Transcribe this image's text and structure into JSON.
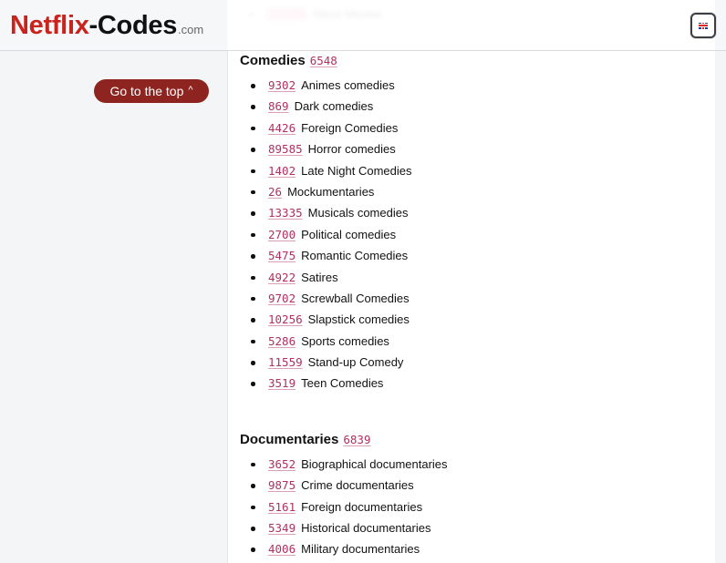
{
  "header": {
    "logo_part1": "Netflix",
    "logo_part2": "-Codes",
    "logo_suffix": ".com",
    "language_button": {
      "icon": "uk-flag-icon",
      "label": "English"
    }
  },
  "blurred_previous_item": {
    "code": "12228",
    "label": "Silent Movies"
  },
  "sidebar": {
    "go_top_label": "Go to the top",
    "go_top_icon": "chevron-up-icon"
  },
  "colors": {
    "brand_red": "#c8231c",
    "button_bg": "#8e2420",
    "link": "#b03060"
  },
  "sections": [
    {
      "title": "Comedies",
      "code": "6548",
      "items": [
        {
          "code": "9302",
          "label": "Animes comedies"
        },
        {
          "code": "869",
          "label": "Dark comedies"
        },
        {
          "code": "4426",
          "label": "Foreign Comedies"
        },
        {
          "code": "89585",
          "label": "Horror comedies"
        },
        {
          "code": "1402",
          "label": "Late Night Comedies"
        },
        {
          "code": "26",
          "label": "Mockumentaries"
        },
        {
          "code": "13335",
          "label": "Musicals comedies"
        },
        {
          "code": "2700",
          "label": "Political comedies"
        },
        {
          "code": "5475",
          "label": "Romantic Comedies"
        },
        {
          "code": "4922",
          "label": "Satires"
        },
        {
          "code": "9702",
          "label": "Screwball Comedies"
        },
        {
          "code": "10256",
          "label": "Slapstick comedies"
        },
        {
          "code": "5286",
          "label": "Sports comedies"
        },
        {
          "code": "11559",
          "label": "Stand-up Comedy"
        },
        {
          "code": "3519",
          "label": "Teen Comedies"
        }
      ]
    },
    {
      "title": "Documentaries",
      "code": "6839",
      "items": [
        {
          "code": "3652",
          "label": "Biographical documentaries"
        },
        {
          "code": "9875",
          "label": "Crime documentaries"
        },
        {
          "code": "5161",
          "label": "Foreign documentaries"
        },
        {
          "code": "5349",
          "label": "Historical documentaries"
        },
        {
          "code": "4006",
          "label": "Military documentaries"
        }
      ]
    }
  ]
}
